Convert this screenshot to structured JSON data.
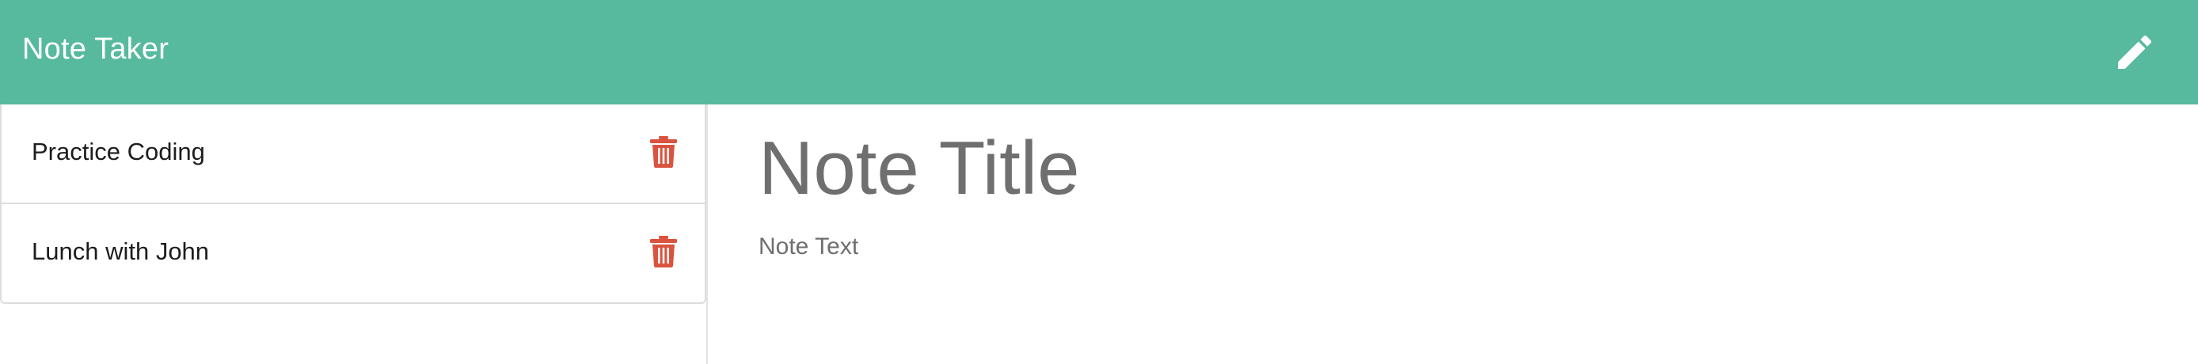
{
  "navbar": {
    "brand": "Note Taker",
    "new_note_icon": "pencil-icon",
    "background_color": "#57ba9f"
  },
  "sidebar": {
    "notes": [
      {
        "title": "Practice Coding",
        "delete_icon": "trash-icon"
      },
      {
        "title": "Lunch with John",
        "delete_icon": "trash-icon"
      }
    ],
    "delete_color": "#d9533f"
  },
  "editor": {
    "title_placeholder": "Note Title",
    "text_placeholder": "Note Text"
  }
}
